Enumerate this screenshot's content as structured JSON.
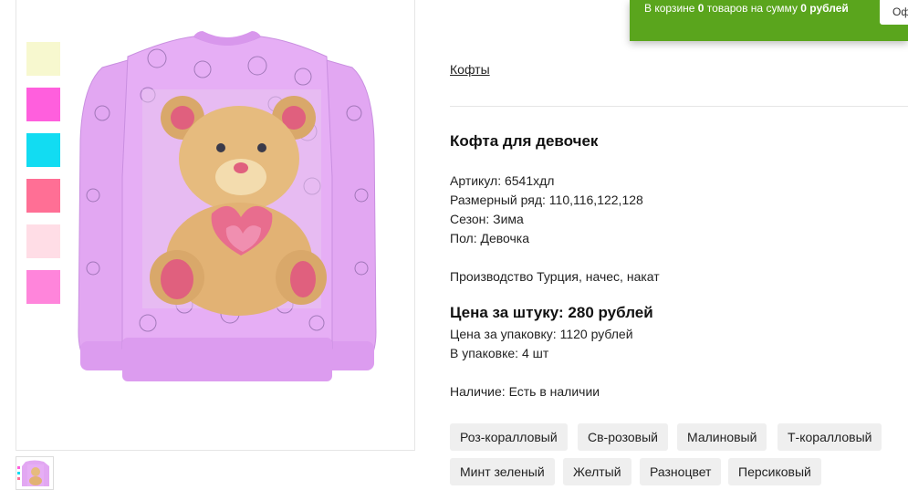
{
  "cart": {
    "prefix": "В корзине ",
    "count": "0",
    "mid": " товаров на сумму ",
    "sum": "0 рублей",
    "button_label": "Оформить"
  },
  "product": {
    "breadcrumb": "Кофты",
    "title": "Кофта для девочек",
    "article": "Артикул: 6541хдл",
    "sizes": "Размерный ряд: 110,116,122,128",
    "season": "Сезон: Зима",
    "gender": "Пол: Девочка",
    "production": "Производство Турция, начес, накат",
    "price_unit": "Цена за штуку: 280 рублей",
    "price_pack": "Цена за упаковку: 1120 рублей",
    "pack_qty": "В упаковке: 4 шт",
    "availability": "Наличие: Есть в наличии"
  },
  "swatches": [
    "#f7f8cf",
    "#ff5fdd",
    "#12dcf2",
    "#ff6f95",
    "#ffdde6",
    "#ff85db"
  ],
  "colors": [
    "Роз-коралловый",
    "Св-розовый",
    "Малиновый",
    "Т-коралловый",
    "Минт зеленый",
    "Желтый",
    "Разноцвет",
    "Персиковый"
  ],
  "image": {
    "icon": "sweater-with-teddy-bear-image"
  }
}
